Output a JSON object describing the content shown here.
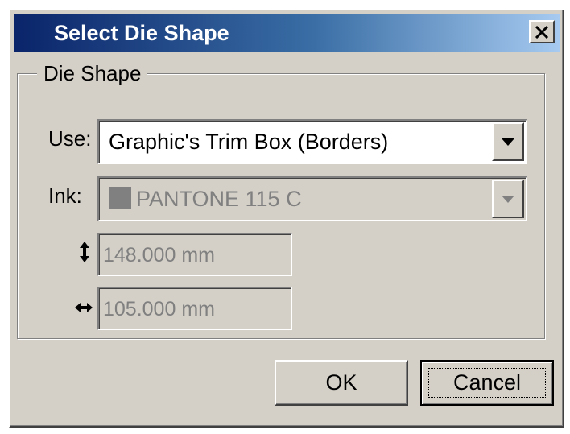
{
  "dialog": {
    "title": "Select Die Shape",
    "close_glyph": "close-x-icon"
  },
  "group": {
    "legend": "Die Shape"
  },
  "use": {
    "label": "Use:",
    "value": "Graphic's Trim Box (Borders)",
    "enabled": true
  },
  "ink": {
    "label": "Ink:",
    "value": "PANTONE 115 C",
    "swatch_color": "#808080",
    "enabled": false
  },
  "height": {
    "icon": "vertical-dimension-icon",
    "value": "148.000 mm",
    "enabled": false
  },
  "width": {
    "icon": "horizontal-dimension-icon",
    "value": "105.000 mm",
    "enabled": false
  },
  "buttons": {
    "ok_label": "OK",
    "cancel_label": "Cancel"
  },
  "colors": {
    "title_gradient_start": "#0a246a",
    "title_gradient_end": "#a6caf0",
    "face": "#d4d0c8"
  }
}
